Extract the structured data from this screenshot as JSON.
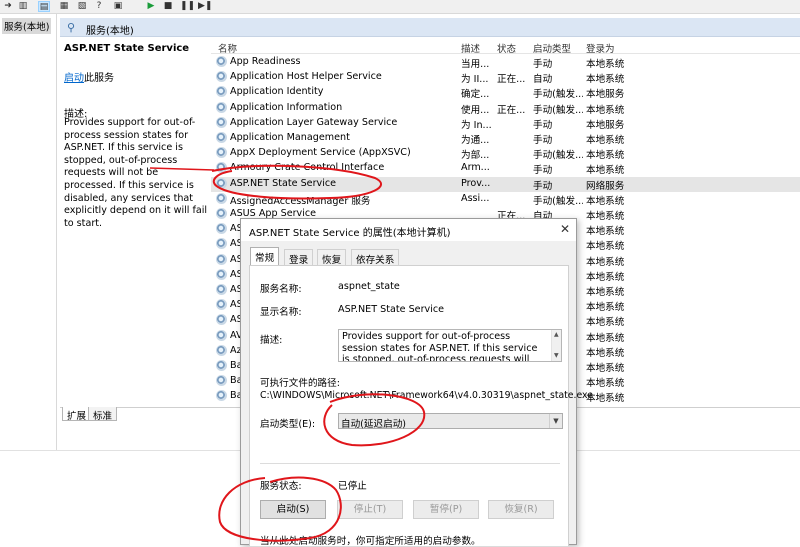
{
  "toolbar": {
    "buttons": [
      "forward-icon",
      "console-tree-icon",
      "list-view-icon",
      "detail-view-icon",
      "help-icon",
      "properties-icon",
      "play-icon",
      "stop-icon",
      "pause-icon",
      "restart-icon"
    ]
  },
  "tree": {
    "root_label": "服务(本地)"
  },
  "panel": {
    "title": "服务(本地)"
  },
  "description": {
    "service_name": "ASP.NET State Service",
    "start_link": "启动",
    "start_suffix": "此服务",
    "label": "描述:",
    "text": "Provides support for out-of-process session states for ASP.NET. If this service is stopped, out-of-process requests will not be processed. If this service is disabled, any services that explicitly depend on it will fail to start."
  },
  "list": {
    "columns": [
      "名称",
      "描述",
      "状态",
      "启动类型",
      "登录为"
    ],
    "rows": [
      {
        "name": "App Readiness",
        "desc": "当用...",
        "status": "",
        "startup": "手动",
        "logon": "本地系统"
      },
      {
        "name": "Application Host Helper Service",
        "desc": "为 II...",
        "status": "正在...",
        "startup": "自动",
        "logon": "本地系统"
      },
      {
        "name": "Application Identity",
        "desc": "确定...",
        "status": "",
        "startup": "手动(触发...",
        "logon": "本地服务"
      },
      {
        "name": "Application Information",
        "desc": "使用...",
        "status": "正在...",
        "startup": "手动(触发...",
        "logon": "本地系统"
      },
      {
        "name": "Application Layer Gateway Service",
        "desc": "为 In...",
        "status": "",
        "startup": "手动",
        "logon": "本地服务"
      },
      {
        "name": "Application Management",
        "desc": "为通...",
        "status": "",
        "startup": "手动",
        "logon": "本地系统"
      },
      {
        "name": "AppX Deployment Service (AppXSVC)",
        "desc": "为部...",
        "status": "",
        "startup": "手动(触发...",
        "logon": "本地系统"
      },
      {
        "name": "Armoury Crate Control Interface",
        "desc": "Arm...",
        "status": "",
        "startup": "手动",
        "logon": "本地系统"
      },
      {
        "name": "ASP.NET State Service",
        "desc": "Prov...",
        "status": "",
        "startup": "手动",
        "logon": "网络服务"
      },
      {
        "name": "AssignedAccessManager 服务",
        "desc": "Assi...",
        "status": "",
        "startup": "手动(触发...",
        "logon": "本地系统"
      },
      {
        "name": "ASUS App Service",
        "desc": "",
        "status": "正在...",
        "startup": "自动",
        "logon": "本地系统"
      },
      {
        "name": "AS",
        "desc": "",
        "status": "",
        "startup": "",
        "logon": "本地系统"
      },
      {
        "name": "AS",
        "desc": "",
        "status": "",
        "startup": "",
        "logon": "本地系统"
      },
      {
        "name": "AS",
        "desc": "",
        "status": "",
        "startup": "",
        "logon": "本地系统"
      },
      {
        "name": "AS",
        "desc": "",
        "status": "",
        "startup": "",
        "logon": "本地系统"
      },
      {
        "name": "AS",
        "desc": "",
        "status": "",
        "startup": "",
        "logon": "本地系统"
      },
      {
        "name": "AS",
        "desc": "",
        "status": "",
        "startup": "",
        "logon": "本地系统"
      },
      {
        "name": "AS",
        "desc": "",
        "status": "",
        "startup": "",
        "logon": "本地系统"
      },
      {
        "name": "AV",
        "desc": "",
        "status": "",
        "startup": "",
        "logon": "本地系统"
      },
      {
        "name": "Azu",
        "desc": "",
        "status": "",
        "startup": "",
        "logon": "本地系统"
      },
      {
        "name": "Bac",
        "desc": "",
        "status": "",
        "startup": "",
        "logon": "本地系统"
      },
      {
        "name": "Bac",
        "desc": "",
        "status": "",
        "startup": "",
        "logon": "本地系统"
      },
      {
        "name": "Bas",
        "desc": "",
        "status": "",
        "startup": "",
        "logon": "本地系统"
      }
    ]
  },
  "bottom_tabs": [
    "扩展",
    "标准"
  ],
  "dialog": {
    "title": "ASP.NET State Service 的属性(本地计算机)",
    "tabs": [
      "常规",
      "登录",
      "恢复",
      "依存关系"
    ],
    "service_name_label": "服务名称:",
    "service_name_value": "aspnet_state",
    "display_name_label": "显示名称:",
    "display_name_value": "ASP.NET State Service",
    "desc_label": "描述:",
    "desc_value": "Provides support for out-of-process session states for ASP.NET. If this service is stopped, out-of-process requests will not be processed. If",
    "exe_label": "可执行文件的路径:",
    "exe_value": "C:\\WINDOWS\\Microsoft.NET\\Framework64\\v4.0.30319\\aspnet_state.exe",
    "startup_label": "启动类型(E):",
    "startup_value": "自动(延迟启动)",
    "status_label": "服务状态:",
    "status_value": "已停止",
    "btn_start": "启动(S)",
    "btn_stop": "停止(T)",
    "btn_pause": "暂停(P)",
    "btn_resume": "恢复(R)",
    "hint": "当从此处启动服务时，你可指定所适用的启动参数。"
  },
  "colors": {
    "annotation": "#e0161b",
    "header_bar": "#dbe6f4",
    "link": "#0066cc"
  }
}
